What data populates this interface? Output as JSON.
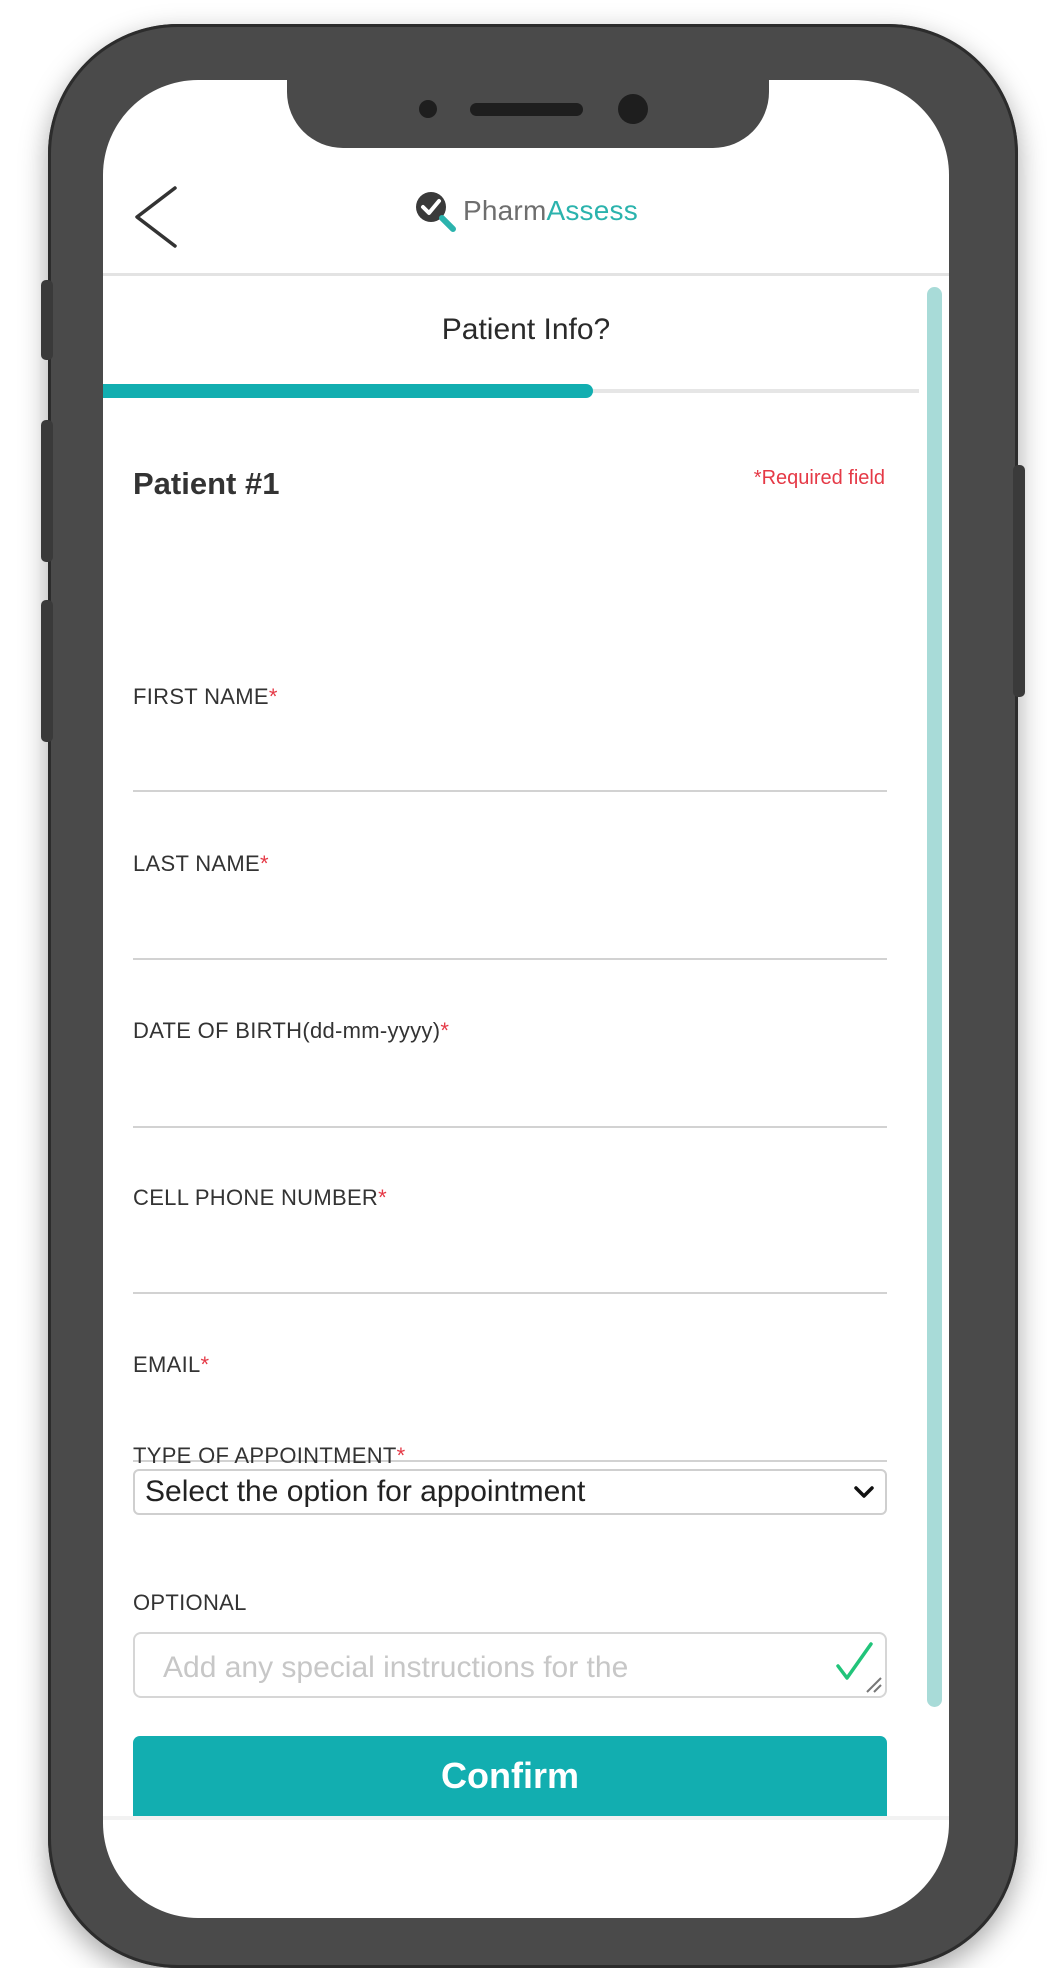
{
  "app": {
    "logo_part1": "Pharm",
    "logo_part2": "Assess",
    "brand_color": "#2bb3ad",
    "accent_color": "#12aeb0",
    "required_color": "#e53946"
  },
  "header": {
    "back_icon": "chevron-left-icon",
    "step_title": "Patient Info?",
    "progress": 0.6
  },
  "form": {
    "patient_heading": "Patient #1",
    "required_note": "*Required field",
    "required_star": "*",
    "fields": [
      {
        "label": "FIRST NAME",
        "value": "",
        "required": true
      },
      {
        "label": "LAST NAME",
        "value": "",
        "required": true
      },
      {
        "label": "DATE OF BIRTH(dd-mm-yyyy)",
        "value": "",
        "required": true
      },
      {
        "label": "CELL PHONE NUMBER",
        "value": "",
        "required": true
      },
      {
        "label": "EMAIL",
        "value": "",
        "required": true
      }
    ],
    "appointment": {
      "label": "TYPE OF APPOINTMENT",
      "selected": "Select the option for appointment"
    },
    "optional": {
      "label": "OPTIONAL",
      "placeholder": "Add any special instructions for the"
    },
    "confirm_label": "Confirm"
  }
}
